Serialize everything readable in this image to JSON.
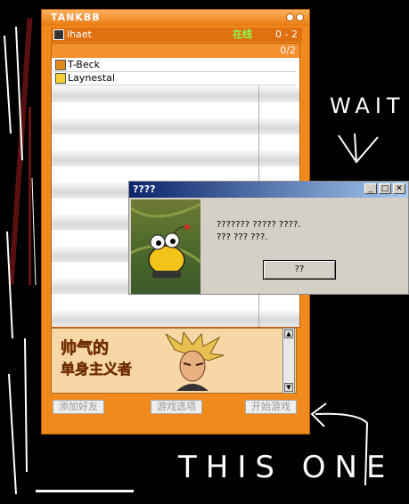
{
  "window": {
    "title": "TANKBB",
    "user": {
      "name": "lhaet",
      "status": "在线",
      "record": "0 - 2"
    },
    "group": {
      "count": "0/2"
    },
    "friends": [
      {
        "name": "T-Beck",
        "icon": "rank-icon"
      },
      {
        "name": "Laynestal",
        "icon": "rank-icon"
      }
    ],
    "banner": {
      "line1": "帅气的",
      "line2": "单身主义者"
    },
    "buttons": {
      "add_friend": "添加好友",
      "game_options": "游戏选项",
      "start_game": "开始游戏"
    }
  },
  "dialog": {
    "title": "????",
    "line1": "??????? ????? ????.",
    "line2": "??? ??? ???.",
    "ok": "??"
  },
  "annotations": {
    "wait": "WAIT",
    "this_one": "THIS ONE"
  }
}
